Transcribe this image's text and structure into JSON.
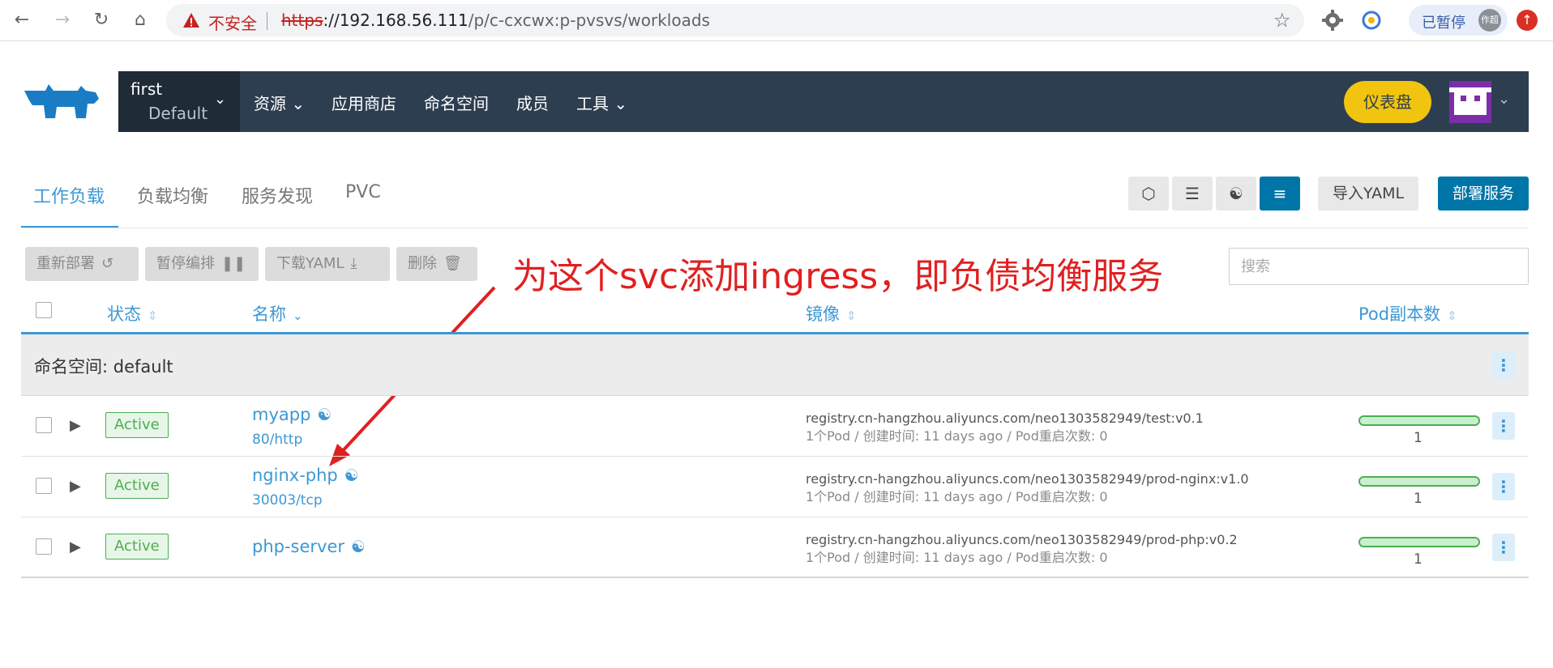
{
  "browser": {
    "not_secure": "不安全",
    "url_scheme": "https",
    "url_host": "://192.168.56.111",
    "url_path": "/p/c-cxcwx:p-pvsvs/workloads",
    "paused_label": "已暂停",
    "avatar_text": "作超"
  },
  "header": {
    "cluster": "first",
    "project": "Default",
    "nav": [
      "资源",
      "应用商店",
      "命名空间",
      "成员",
      "工具"
    ],
    "dashboard_button": "仪表盘"
  },
  "tabs": [
    {
      "label": "工作负载",
      "active": true
    },
    {
      "label": "负载均衡",
      "active": false
    },
    {
      "label": "服务发现",
      "active": false
    },
    {
      "label": "PVC",
      "active": false
    }
  ],
  "toolbar": {
    "import_yaml": "导入YAML",
    "deploy": "部署服务"
  },
  "bulk_actions": {
    "redeploy": "重新部署",
    "pause": "暂停编排",
    "download_yaml": "下载YAML",
    "delete": "删除"
  },
  "search": {
    "placeholder": "搜索"
  },
  "annotation": "为这个svc添加ingress，即负债均衡服务",
  "table": {
    "columns": {
      "state": "状态",
      "name": "名称",
      "image": "镜像",
      "pods": "Pod副本数"
    },
    "namespace_label": "命名空间: default",
    "rows": [
      {
        "state": "Active",
        "name": "myapp",
        "port": "80/http",
        "image": "registry.cn-hangzhou.aliyuncs.com/neo1303582949/test:v0.1",
        "meta": "1个Pod / 创建时间: 11 days ago / Pod重启次数: 0",
        "pods": "1",
        "pod_fraction": 1.0
      },
      {
        "state": "Active",
        "name": "nginx-php",
        "port": "30003/tcp",
        "image": "registry.cn-hangzhou.aliyuncs.com/neo1303582949/prod-nginx:v1.0",
        "meta": "1个Pod / 创建时间: 11 days ago / Pod重启次数: 0",
        "pods": "1",
        "pod_fraction": 1.0
      },
      {
        "state": "Active",
        "name": "php-server",
        "port": "",
        "image": "registry.cn-hangzhou.aliyuncs.com/neo1303582949/prod-php:v0.2",
        "meta": "1个Pod / 创建时间: 11 days ago / Pod重启次数: 0",
        "pods": "1",
        "pod_fraction": 1.0
      }
    ]
  },
  "colors": {
    "accent": "#3d98d3",
    "nav_bg": "#2d3e50",
    "primary_button": "#0075a8",
    "dashboard": "#f1c40f",
    "active_green": "#4caf50",
    "annotation_red": "#e02020"
  }
}
